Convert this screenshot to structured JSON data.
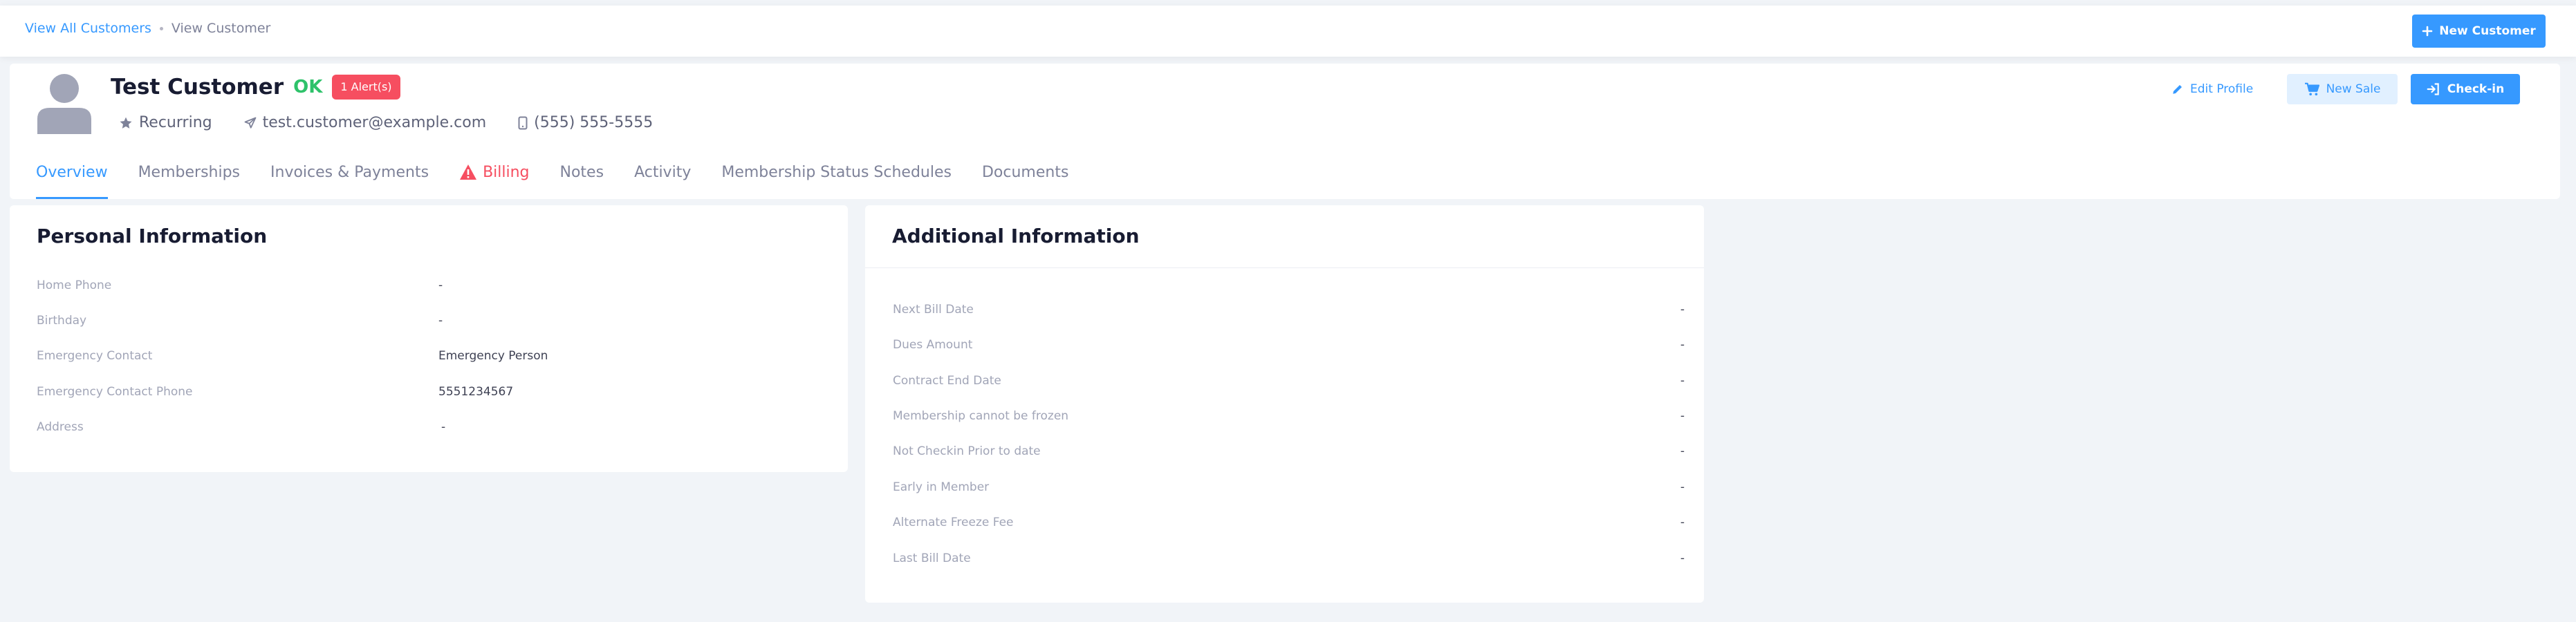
{
  "breadcrumb": {
    "link": "View All Customers",
    "current": "View Customer"
  },
  "toolbar": {
    "new_customer_label": "New Customer"
  },
  "customer": {
    "name": "Test Customer",
    "status": "OK",
    "alerts": "1 Alert(s)",
    "type": "Recurring",
    "email": "test.customer@example.com",
    "phone": "(555) 555-5555"
  },
  "actions": {
    "edit_profile": "Edit Profile",
    "new_sale": "New Sale",
    "check_in": "Check-in"
  },
  "tabs": [
    {
      "label": "Overview"
    },
    {
      "label": "Memberships"
    },
    {
      "label": "Invoices & Payments"
    },
    {
      "label": "Billing"
    },
    {
      "label": "Notes"
    },
    {
      "label": "Activity"
    },
    {
      "label": "Membership Status Schedules"
    },
    {
      "label": "Documents"
    }
  ],
  "personal": {
    "title": "Personal Information",
    "fields": [
      {
        "label": "Home Phone",
        "value": "-"
      },
      {
        "label": "Birthday",
        "value": "-"
      },
      {
        "label": "Emergency Contact",
        "value": "Emergency Person"
      },
      {
        "label": "Emergency Contact Phone",
        "value": "5551234567"
      },
      {
        "label": "Address",
        "value": "-"
      }
    ]
  },
  "additional": {
    "title": "Additional Information",
    "fields": [
      {
        "label": "Next Bill Date",
        "value": "-"
      },
      {
        "label": "Dues Amount",
        "value": "-"
      },
      {
        "label": "Contract End Date",
        "value": "-"
      },
      {
        "label": "Membership cannot be frozen",
        "value": "-"
      },
      {
        "label": "Not Checkin Prior to date",
        "value": "-"
      },
      {
        "label": "Early in Member",
        "value": "-"
      },
      {
        "label": "Alternate Freeze Fee",
        "value": "-"
      },
      {
        "label": "Last Bill Date",
        "value": "-"
      }
    ]
  },
  "colors": {
    "primary": "#3699ff",
    "danger": "#f64e60",
    "success": "#2ec26a"
  },
  "icons": {
    "new_customer": "plus-icon",
    "type": "star-icon",
    "email": "paper-plane-icon",
    "phone": "mobile-phone-icon",
    "edit": "pencil-icon",
    "sale": "cart-icon",
    "checkin": "sign-in-icon",
    "billing": "warning-triangle-icon",
    "avatar": "user-silhouette-icon"
  }
}
